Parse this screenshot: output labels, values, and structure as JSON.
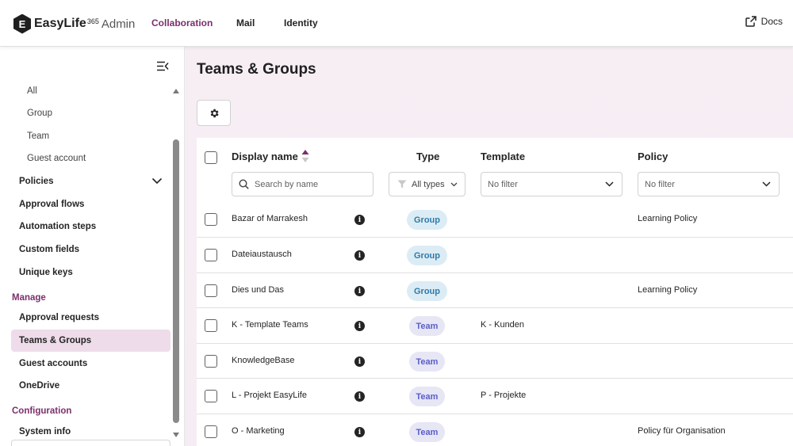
{
  "header": {
    "logo_letter": "E",
    "brand": "EasyLife",
    "brand_sup": "365",
    "brand_suffix": "Admin",
    "nav": [
      {
        "label": "Collaboration",
        "active": true
      },
      {
        "label": "Mail",
        "active": false
      },
      {
        "label": "Identity",
        "active": false
      }
    ],
    "docs_label": "Docs"
  },
  "sidebar": {
    "sub_items": [
      "All",
      "Group",
      "Team",
      "Guest account"
    ],
    "main_items": [
      "Policies",
      "Approval flows",
      "Automation steps",
      "Custom fields",
      "Unique keys"
    ],
    "sections": [
      {
        "title": "Manage",
        "items": [
          "Approval requests",
          "Teams & Groups",
          "Guest accounts",
          "OneDrive"
        ]
      },
      {
        "title": "Configuration",
        "items": [
          "System info"
        ]
      }
    ],
    "active_item": "Teams & Groups"
  },
  "main": {
    "title": "Teams & Groups",
    "columns": {
      "display_name": "Display name",
      "type": "Type",
      "template": "Template",
      "policy": "Policy"
    },
    "filters": {
      "search_placeholder": "Search by name",
      "type_filter": "All types",
      "template_filter": "No filter",
      "policy_filter": "No filter"
    },
    "rows": [
      {
        "name": "Bazar of Marrakesh",
        "type": "Group",
        "template": "",
        "policy": "Learning Policy"
      },
      {
        "name": "Dateiaustausch",
        "type": "Group",
        "template": "",
        "policy": ""
      },
      {
        "name": "Dies und Das",
        "type": "Group",
        "template": "",
        "policy": "Learning Policy"
      },
      {
        "name": "K - Template Teams",
        "type": "Team",
        "template": "K - Kunden",
        "policy": ""
      },
      {
        "name": "KnowledgeBase",
        "type": "Team",
        "template": "",
        "policy": ""
      },
      {
        "name": "L - Projekt EasyLife",
        "type": "Team",
        "template": "P - Projekte",
        "policy": ""
      },
      {
        "name": "O - Marketing",
        "type": "Team",
        "template": "",
        "policy": "Policy für Organisation"
      }
    ]
  },
  "colors": {
    "accent": "#7b2f6b",
    "active_bg": "#eedcea",
    "group_badge_bg": "#dcecf5",
    "group_badge_fg": "#2f7aa8",
    "team_badge_bg": "#e6e6f5",
    "team_badge_fg": "#5b5fc7"
  }
}
